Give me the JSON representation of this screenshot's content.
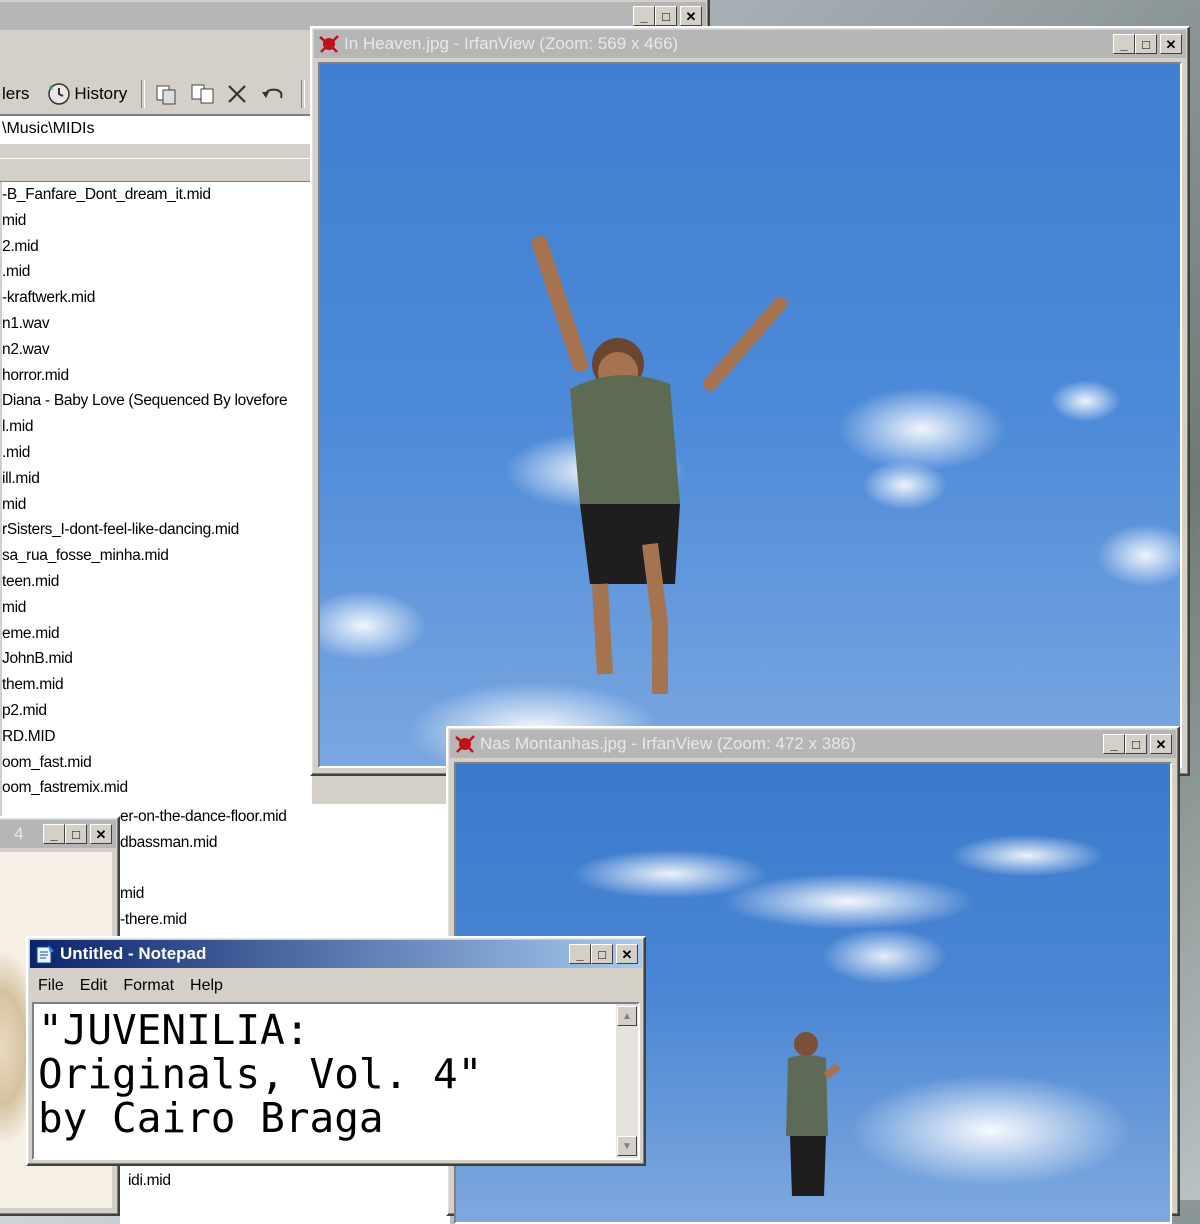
{
  "explorer": {
    "toolbar": {
      "folders_label": "lers",
      "history_label": "History"
    },
    "address_path": "\\Music\\MIDIs",
    "files": [
      "-B_Fanfare_Dont_dream_it.mid",
      "mid",
      " 2.mid",
      ".mid",
      "-kraftwerk.mid",
      "n1.wav",
      "n2.wav",
      "horror.mid",
      "Diana - Baby Love (Sequenced By lovefore",
      "l.mid",
      ".mid",
      "ill.mid",
      "mid",
      "rSisters_I-dont-feel-like-dancing.mid",
      "sa_rua_fosse_minha.mid",
      "teen.mid",
      "mid",
      "eme.mid",
      "JohnB.mid",
      "them.mid",
      "p2.mid",
      "RD.MID",
      "oom_fast.mid",
      "oom_fastremix.mid"
    ],
    "files_lower": [
      "er-on-the-dance-floor.mid",
      "dbassman.mid",
      "",
      "mid",
      "-there.mid"
    ],
    "files_bottom": [
      "idi.mid"
    ]
  },
  "irfan1": {
    "title": "In Heaven.jpg - IrfanView (Zoom: 569 x 466)",
    "image_label": "In Heaven.jpg"
  },
  "irfan2": {
    "title": "Nas Montanhas.jpg - IrfanView (Zoom: 472 x 386)",
    "image_label": "Nas Montanhas.jpg"
  },
  "small_window": {
    "title_fragment": "4"
  },
  "notepad": {
    "title": "Untitled - Notepad",
    "menu": [
      "File",
      "Edit",
      "Format",
      "Help"
    ],
    "text": "\"JUVENILIA:\nOriginals, Vol. 4\"\nby Cairo Braga"
  },
  "window_controls": {
    "minimize": "_",
    "maximize": "□",
    "close": "✕"
  },
  "colors": {
    "active_title_start": "#0a246a",
    "active_title_end": "#a6caf0",
    "inactive_title": "#b6b6b6",
    "window_face": "#d4d0c8",
    "sky": "#4d8ad8"
  }
}
